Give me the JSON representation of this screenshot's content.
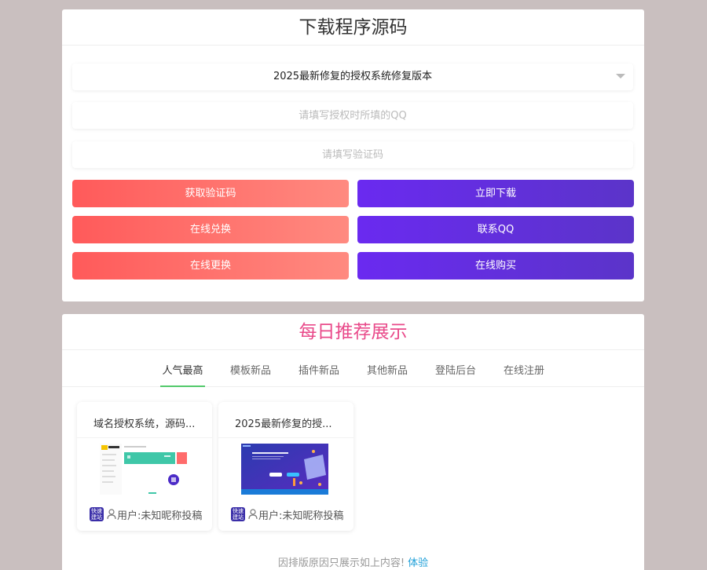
{
  "download": {
    "title": "下载程序源码",
    "selected_version": "2025最新修复的授权系统修复版本",
    "qq_placeholder": "请填写授权时所填的QQ",
    "code_placeholder": "请填写验证码",
    "buttons": {
      "get_code": "获取验证码",
      "download_now": "立即下载",
      "exchange_online": "在线兑换",
      "contact_qq": "联系QQ",
      "replace_online": "在线更换",
      "buy_online": "在线购买"
    }
  },
  "recommend": {
    "title": "每日推荐展示",
    "tabs": [
      "人气最高",
      "模板新品",
      "插件新品",
      "其他新品",
      "登陆后台",
      "在线注册"
    ],
    "active_tab": 0,
    "items": [
      {
        "name": "域名授权系统，源码...",
        "badge": "快速建站",
        "author": "用户:未知昵称投稿"
      },
      {
        "name": "2025最新修复的授...",
        "badge": "快速建站",
        "author": "用户:未知昵称投稿"
      }
    ],
    "notice": "因排版原因只展示如上内容!",
    "notice_link": "体验"
  },
  "colors": {
    "background": "#c9bfbf",
    "recommend_title": "#e94a8a",
    "button_red": "#ff5a5a",
    "button_purple": "#6a2af0",
    "active_tab_underline": "#52c96b",
    "link": "#1e9fd8"
  }
}
